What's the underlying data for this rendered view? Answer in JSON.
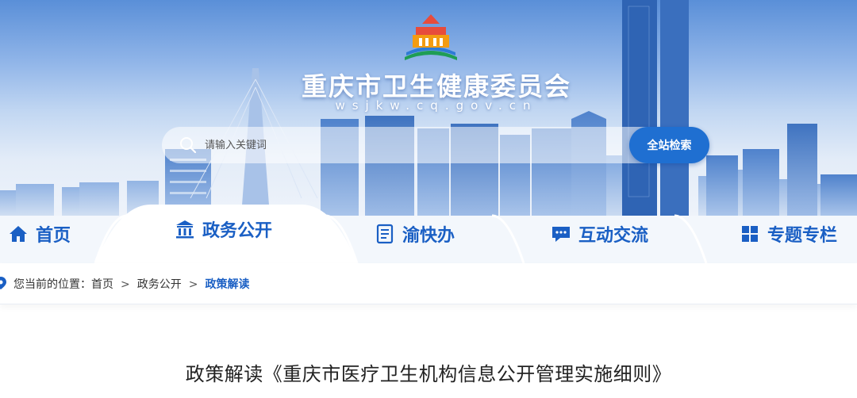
{
  "header": {
    "site_title": "重庆市卫生健康委员会",
    "site_url": "wsjkw.cq.gov.cn"
  },
  "search": {
    "placeholder": "请输入关键词",
    "button_label": "全站检索"
  },
  "nav": {
    "items": [
      {
        "label": "首页",
        "icon": "home-icon"
      },
      {
        "label": "政务公开",
        "icon": "government-building-icon",
        "active": true
      },
      {
        "label": "渝快办",
        "icon": "document-list-icon"
      },
      {
        "label": "互动交流",
        "icon": "chat-bubble-icon"
      },
      {
        "label": "专题专栏",
        "icon": "grid-icon"
      }
    ]
  },
  "breadcrumb": {
    "prefix": "您当前的位置：",
    "items": [
      "首页",
      "政务公开",
      "政策解读"
    ],
    "separator": ">"
  },
  "article": {
    "title": "政策解读《重庆市医疗卫生机构信息公开管理实施细则》"
  },
  "colors": {
    "primary": "#1a5fc4",
    "button": "#1f6fd1",
    "sky_top": "#5a8fd8"
  }
}
